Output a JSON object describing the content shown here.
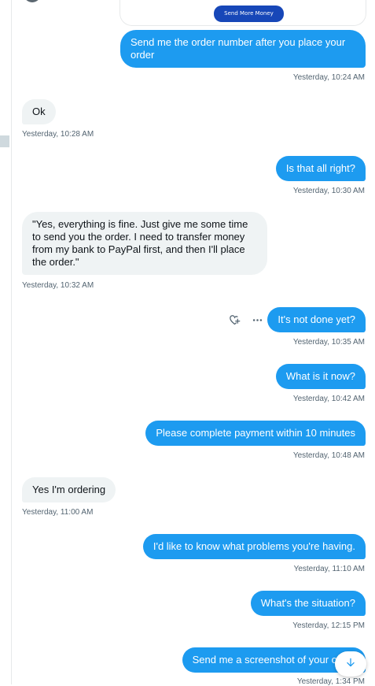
{
  "card": {
    "button_label": "Send More Money"
  },
  "messages": [
    {
      "dir": "out",
      "text": "Send me the order number after you place your order",
      "time": "Yesterday, 10:24 AM"
    },
    {
      "dir": "in",
      "text": "Ok",
      "time": "Yesterday, 10:28 AM"
    },
    {
      "dir": "out",
      "text": "Is that all right?",
      "time": "Yesterday, 10:30 AM"
    },
    {
      "dir": "in",
      "text": "\"Yes, everything is fine. Just give me some time to send you the order. I need to transfer money from my bank to PayPal first, and then I'll place the order.\"",
      "time": "Yesterday, 10:32 AM"
    },
    {
      "dir": "out",
      "text": "It's not done yet?",
      "time": "Yesterday, 10:35 AM"
    },
    {
      "dir": "out",
      "text": "What is it now?",
      "time": "Yesterday, 10:42 AM"
    },
    {
      "dir": "out",
      "text": "Please complete payment within 10 minutes",
      "time": "Yesterday, 10:48 AM"
    },
    {
      "dir": "in",
      "text": "Yes I'm ordering",
      "time": "Yesterday, 11:00 AM"
    },
    {
      "dir": "out",
      "text": "I'd like to know what problems you're having.",
      "time": "Yesterday, 11:10 AM"
    },
    {
      "dir": "out",
      "text": "What's the situation?",
      "time": "Yesterday, 12:15 PM"
    },
    {
      "dir": "out",
      "text": "Send me a screenshot of your order",
      "time": "Yesterday, 1:34 PM"
    }
  ],
  "icons": {
    "react": "heart-plus-icon",
    "more": "more-horizontal-icon",
    "scroll": "arrow-down-icon"
  },
  "colors": {
    "outgoing": "#1d9bf0",
    "incoming": "#eff3f4",
    "button": "#1747b8",
    "timestamp": "#536471"
  }
}
